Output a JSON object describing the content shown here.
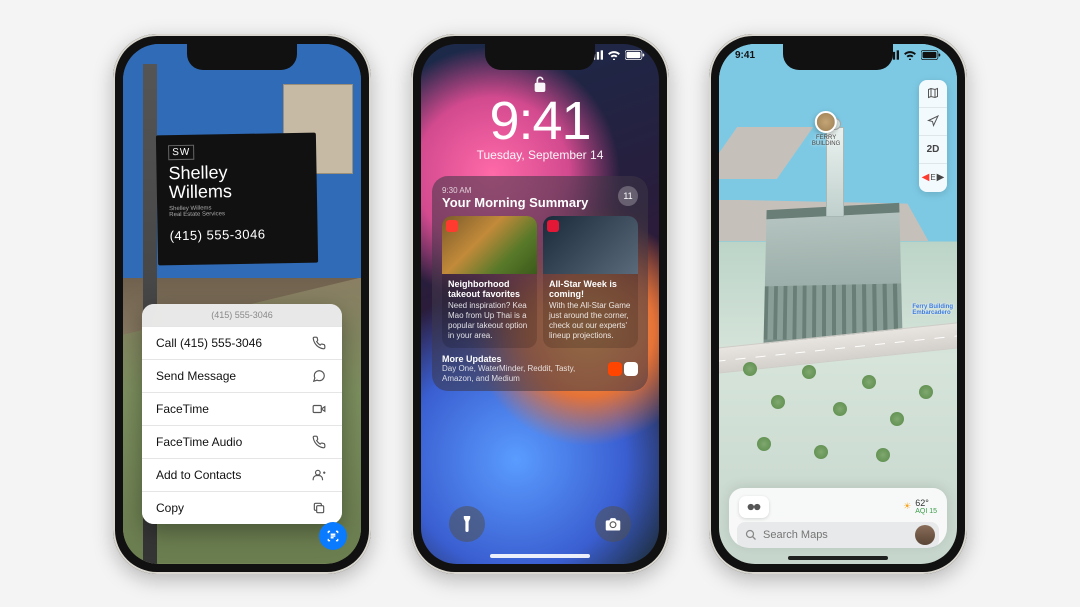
{
  "phone1": {
    "sign": {
      "logo": "SW",
      "name": "Shelley\nWillems",
      "sub": "Shelley Willems\nReal Estate Services",
      "phone": "(415) 555-3046"
    },
    "sheet_header": "(415) 555-3046",
    "actions": [
      {
        "label": "Call (415) 555-3046",
        "icon": "phone"
      },
      {
        "label": "Send Message",
        "icon": "message"
      },
      {
        "label": "FaceTime",
        "icon": "video"
      },
      {
        "label": "FaceTime Audio",
        "icon": "phone"
      },
      {
        "label": "Add to Contacts",
        "icon": "contact-add"
      },
      {
        "label": "Copy",
        "icon": "copy"
      }
    ]
  },
  "phone2": {
    "clock": "9:41",
    "date": "Tuesday, September 14",
    "summary": {
      "time": "9:30 AM",
      "title": "Your Morning Summary",
      "count": "11",
      "cards": [
        {
          "title": "Neighborhood takeout favorites",
          "desc": "Need inspiration? Kea Mao from Up Thai is a popular takeout option in your area."
        },
        {
          "title": "All-Star Week is coming!",
          "desc": "With the All-Star Game just around the corner, check out our experts' lineup projections."
        }
      ],
      "more_title": "More Updates",
      "more_desc": "Day One, WaterMinder, Reddit, Tasty, Amazon, and Medium"
    }
  },
  "phone3": {
    "time": "9:41",
    "landmark": "FERRY\nBUILDING",
    "station": "Ferry Building\nEmbarcadero",
    "map_buttons": {
      "mode": "2D",
      "compass": "E"
    },
    "weather": {
      "temp": "62°",
      "aqi": "AQI 15"
    },
    "search_placeholder": "Search Maps"
  }
}
